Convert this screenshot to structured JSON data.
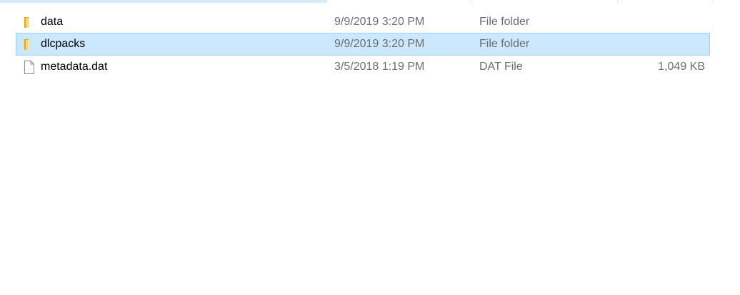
{
  "files": [
    {
      "name": "data",
      "date_modified": "9/9/2019 3:20 PM",
      "type": "File folder",
      "size": "",
      "icon": "folder-icon"
    },
    {
      "name": "dlcpacks",
      "date_modified": "9/9/2019 3:20 PM",
      "type": "File folder",
      "size": "",
      "icon": "folder-icon"
    },
    {
      "name": "metadata.dat",
      "date_modified": "3/5/2018 1:19 PM",
      "type": "DAT File",
      "size": "1,049 KB",
      "icon": "file-icon"
    }
  ],
  "selected_index": 1,
  "colors": {
    "selection_bg": "#cce8ff",
    "selection_border": "#99d1ff",
    "folder_yellow": "#f8d775",
    "folder_dark": "#e0a526"
  }
}
